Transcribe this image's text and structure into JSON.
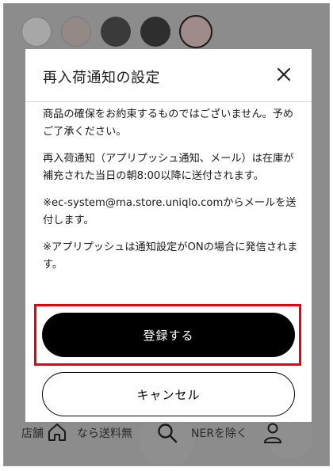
{
  "modal": {
    "title": "再入荷通知の設定",
    "paragraphs": [
      "商品の確保をお約束するものではございません。予めご了承ください。",
      "再入荷通知（アプリプッシュ通知、メール）は在庫が補充された当日の朝8:00以降に送付されます。",
      "※ec-system@ma.store.uniqlo.comからメールを送付します。",
      "※アプリプッシュは通知設定がONの場合に発信されます。"
    ],
    "primary_button": "登録する",
    "secondary_button": "キャンセル"
  },
  "background": {
    "promo_text_left": "店舗",
    "promo_text_mid": "なら送料無",
    "promo_text_right": "NERを除く"
  },
  "colors": {
    "overlay": "#8c8c8c",
    "accent_highlight": "#e60012",
    "primary_button": "#000000",
    "swatches": [
      "#a7a7a7",
      "#938a88",
      "#3a3a3a",
      "#2e2e2e",
      "#9f8c8a"
    ]
  },
  "icons": {
    "close": "close-icon",
    "home": "home-icon",
    "search": "search-icon",
    "account": "user-icon"
  }
}
